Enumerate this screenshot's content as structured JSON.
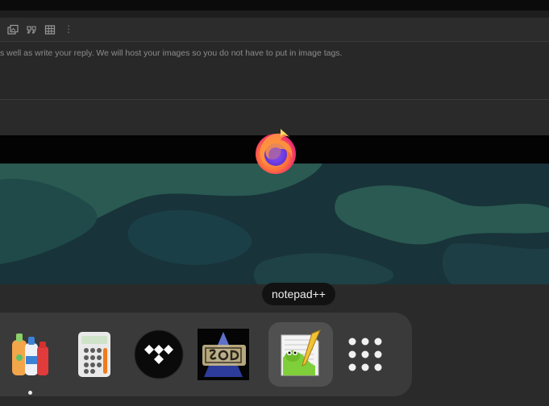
{
  "editor": {
    "toolbar_icons": [
      "image-gallery-icon",
      "quote-icon",
      "table-icon",
      "more-vertical-icon"
    ],
    "reply_hint": "s well as write your reply. We will host your images so you do not have to put in image tags."
  },
  "drag": {
    "icon": "firefox-icon"
  },
  "tooltip": {
    "label": "notepad++"
  },
  "dock": {
    "items": [
      {
        "icon": "bottles-icon",
        "running": true
      },
      {
        "icon": "calculator-icon",
        "running": false
      },
      {
        "icon": "tidal-icon",
        "running": false
      },
      {
        "icon": "sod-game-icon",
        "running": false
      },
      {
        "icon": "notepad-plus-plus-icon",
        "running": false,
        "hovered": true
      },
      {
        "icon": "app-grid-icon",
        "running": false
      }
    ]
  },
  "colors": {
    "panel_bg": "#232323",
    "dock_bg": "#3a3a3a",
    "tooltip_bg": "#121212",
    "wallpaper": "#1c3a40",
    "firefox_orange": "#ff7139",
    "firefox_purple": "#7542e5"
  }
}
